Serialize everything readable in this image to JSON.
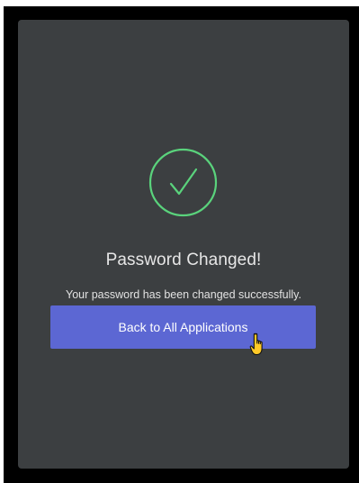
{
  "dialog": {
    "title": "Password Changed!",
    "message": "Your password has been changed successfully.",
    "button_label": "Back to All Applications"
  },
  "icons": {
    "status": "check-circle-icon",
    "pointer": "hand-pointer-cursor-icon"
  },
  "colors": {
    "card_background": "#3c3f41",
    "success_green": "#5ad37c",
    "button_primary": "#5c67d3",
    "text_primary": "#e6e6e6"
  }
}
